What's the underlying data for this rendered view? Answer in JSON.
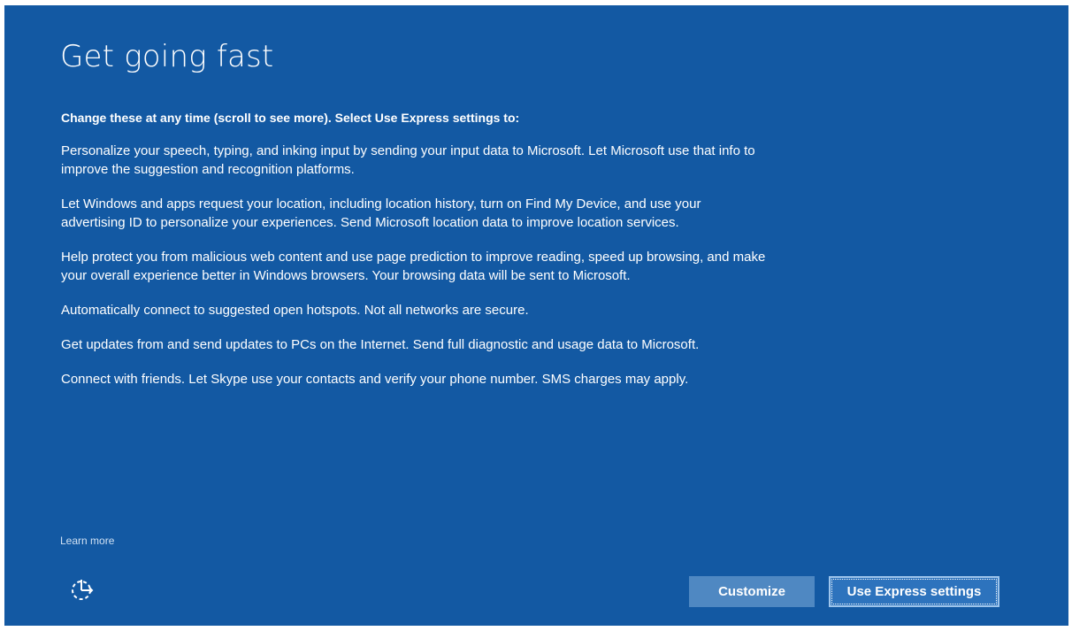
{
  "page": {
    "title": "Get going fast",
    "intro": "Change these at any time (scroll to see more). Select Use Express settings to:",
    "paragraphs": [
      "Personalize your speech, typing, and inking input by sending your input data to Microsoft. Let Microsoft use that info to improve the suggestion and recognition platforms.",
      "Let Windows and apps request your location, including location history, turn on Find My Device, and use your advertising ID to personalize your experiences. Send Microsoft location data to improve location services.",
      "Help protect you from malicious web content and use page prediction to improve reading, speed up browsing, and make your overall experience better in Windows browsers. Your browsing data will be sent to Microsoft.",
      "Automatically connect to suggested open hotspots. Not all networks are secure.",
      "Get updates from and send updates to PCs on the Internet. Send full diagnostic and usage data to Microsoft.",
      "Connect with friends. Let Skype use your contacts and verify your phone number. SMS charges may apply."
    ],
    "learn_more": "Learn more"
  },
  "footer": {
    "ease_of_access_icon": "ease-of-access-icon",
    "customize_label": "Customize",
    "express_label": "Use Express settings"
  },
  "colors": {
    "background": "#1359a3",
    "customize_button": "#4f88c2",
    "express_button": "#2d73bd",
    "text": "#ffffff"
  }
}
